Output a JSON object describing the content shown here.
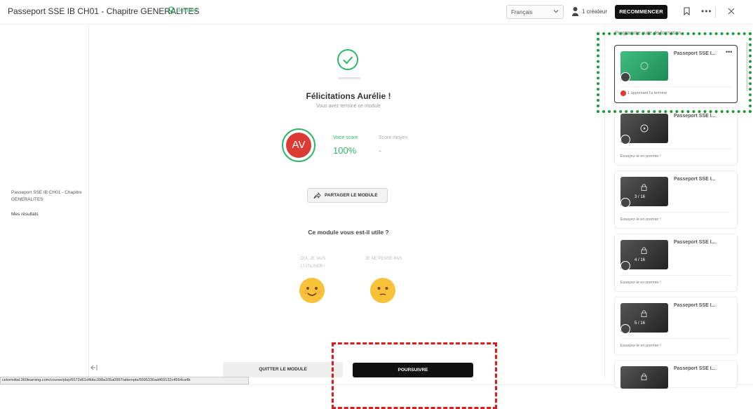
{
  "header": {
    "title": "Passeport SSE IB CH01 - Chapitre GENERALITES",
    "status": "Terminé",
    "language": "Français",
    "creators": "1 créateur",
    "restart_label": "RECOMMENCER"
  },
  "left_panel": {
    "module_title": "Passeport SSE IB CH01 - Chapitre GENERALITES",
    "results_link": "Mes résultats"
  },
  "main": {
    "congrats": "Félicitations Aurélie !",
    "subtitle": "Vous avez terminé ce module",
    "avatar_initials": "AV",
    "your_score_label": "Votre score",
    "your_score_value": "100%",
    "avg_score_label": "Score moyen",
    "avg_score_value": "-",
    "share_label": "PARTAGER LE MODULE",
    "useful_question": "Ce module vous est-il utile ?",
    "feedback_yes": "OUI, JE VAIS L'UTILISER !",
    "feedback_no": "JE NE PENSE PAS"
  },
  "footer": {
    "quit_label": "QUITTER LE MODULE",
    "continue_label": "POURSUIVRE",
    "status_url": "celormittal.360learning.com/course/play/6572d61d4bbc398a105a0997/attempts/6595330ad469132c4554ca4b"
  },
  "sidebar": {
    "title": "Programme suite de formation",
    "cards": [
      {
        "name": "Passeport SSE I...",
        "thumb_label": "",
        "sub": "1 apprenant l'a terminé",
        "active": true
      },
      {
        "name": "Passeport SSE I...",
        "thumb_label": "",
        "sub": "Essayez-le en premier !",
        "active": false
      },
      {
        "name": "Passeport SSE I...",
        "thumb_label": "3 / 16",
        "sub": "Essayez-le en premier !",
        "active": false
      },
      {
        "name": "Passeport SSE I...",
        "thumb_label": "4 / 16",
        "sub": "Essayez-le en premier !",
        "active": false
      },
      {
        "name": "Passeport SSE I...",
        "thumb_label": "5 / 16",
        "sub": "Essayez-le en premier !",
        "active": false
      },
      {
        "name": "Passeport SSE I...",
        "thumb_label": "",
        "sub": "",
        "active": false
      }
    ]
  },
  "colors": {
    "accent_green": "#2fb76b",
    "avatar_red": "#dc3b34",
    "highlight_red": "#d81f1f",
    "highlight_green": "#1f9a3a"
  }
}
